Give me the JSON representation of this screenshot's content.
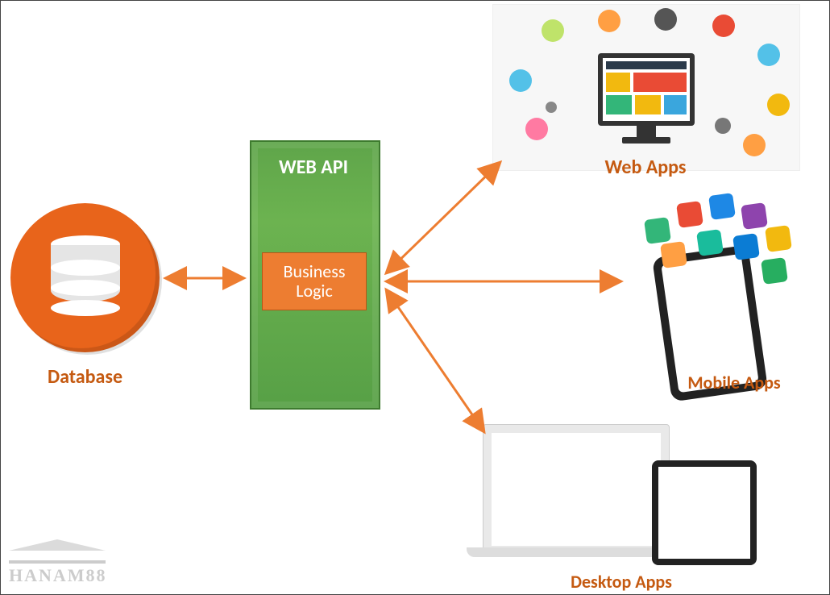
{
  "nodes": {
    "database": {
      "label": "Database"
    },
    "api": {
      "title": "WEB API",
      "business_box": "Business\nLogic"
    },
    "clients": {
      "web": {
        "label": "Web Apps"
      },
      "mobile": {
        "label": "Mobile Apps"
      },
      "desktop": {
        "label": "Desktop Apps"
      }
    }
  },
  "arrows": [
    {
      "from": "database",
      "to": "api",
      "bidirectional": true
    },
    {
      "from": "api",
      "to": "web",
      "bidirectional": true
    },
    {
      "from": "api",
      "to": "mobile",
      "bidirectional": true
    },
    {
      "from": "api",
      "to": "desktop",
      "bidirectional": true
    }
  ],
  "watermark": "HANAM88",
  "colors": {
    "accent_orange": "#ED7D31",
    "text_orange": "#C55A11",
    "api_green": "#5FA54A",
    "db_orange": "#E8641B"
  }
}
